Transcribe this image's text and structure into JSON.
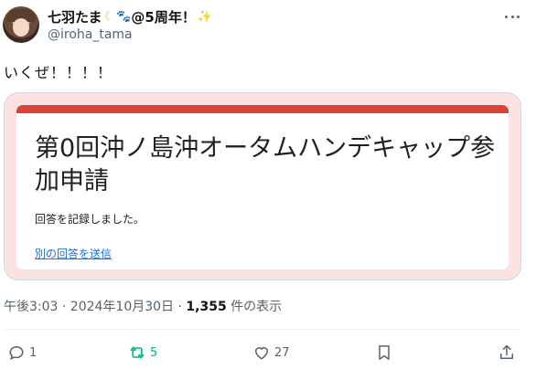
{
  "user": {
    "display_name": "七羽たま",
    "name_suffix": "@5周年！",
    "handle": "@iroha_tama"
  },
  "tweet": {
    "text": "いくぜ！！！！"
  },
  "card": {
    "title": "第0回沖ノ島沖オータムハンデキャップ参加申請",
    "message": "回答を記録しました。",
    "link_text": "別の回答を送信",
    "accent_color": "#db4437"
  },
  "meta": {
    "timestamp": "午後3:03 · 2024年10月30日 · ",
    "views_count": "1,355",
    "views_label": " 件の表示"
  },
  "actions": {
    "reply_count": "1",
    "retweet_count": "5",
    "like_count": "27",
    "retweet_color": "#00ba7c"
  }
}
